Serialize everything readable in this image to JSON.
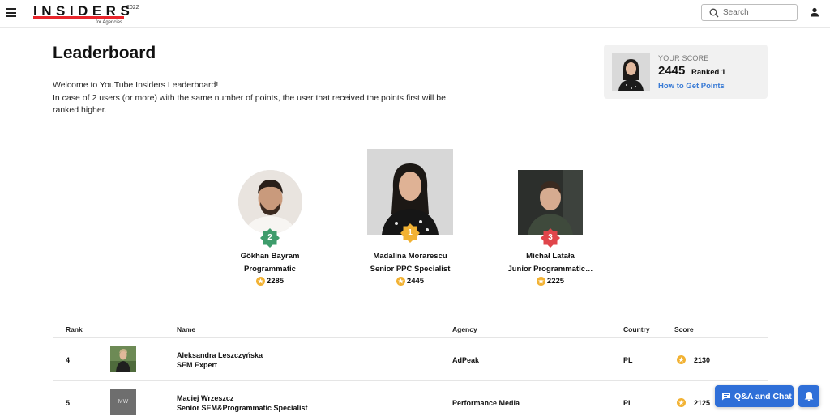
{
  "header": {
    "logo_word": "INSIDERS",
    "logo_year": "2022",
    "logo_sub": "for Agencies",
    "search_placeholder": "Search",
    "brand_color": "#e8262c"
  },
  "page": {
    "title": "Leaderboard",
    "intro_line1": "Welcome to YouTube Insiders Leaderboard!",
    "intro_line2": "In case of 2 users (or more) with the same number of points, the user that received the points first will be ranked higher."
  },
  "your_score": {
    "label": "YOUR SCORE",
    "value": "2445",
    "rank": "Ranked 1",
    "link": "How to Get Points"
  },
  "podium": {
    "second": {
      "medal": "2",
      "name": "Gökhan Bayram",
      "role": "Programmatic",
      "score": "2285",
      "medal_color": "#3e9c6b"
    },
    "first": {
      "medal": "1",
      "name": "Madalina Morarescu",
      "role": "Senior PPC Specialist",
      "score": "2445",
      "medal_color": "#f2b233"
    },
    "third": {
      "medal": "3",
      "name": "Michał Latała",
      "role": "Junior Programmatic…",
      "score": "2225",
      "medal_color": "#e0454b"
    }
  },
  "table": {
    "columns": {
      "rank": "Rank",
      "name": "Name",
      "agency": "Agency",
      "country": "Country",
      "score": "Score"
    },
    "rows": [
      {
        "rank": "4",
        "name": "Aleksandra Leszczyńska",
        "role": "SEM Expert",
        "agency": "AdPeak",
        "country": "PL",
        "score": "2130",
        "avatar": "photo"
      },
      {
        "rank": "5",
        "name": "Maciej Wrzeszcz",
        "role": "Senior SEM&Programmatic Specialist",
        "agency": "Performance Media",
        "country": "PL",
        "score": "2125",
        "avatar_initials": "MW"
      }
    ]
  },
  "floating": {
    "qa_label": "Q&A and Chat",
    "accent_color": "#2f6fd8"
  },
  "icons": [
    "menu-icon",
    "search-icon",
    "user-icon",
    "coin-icon",
    "chat-icon",
    "bell-icon"
  ]
}
